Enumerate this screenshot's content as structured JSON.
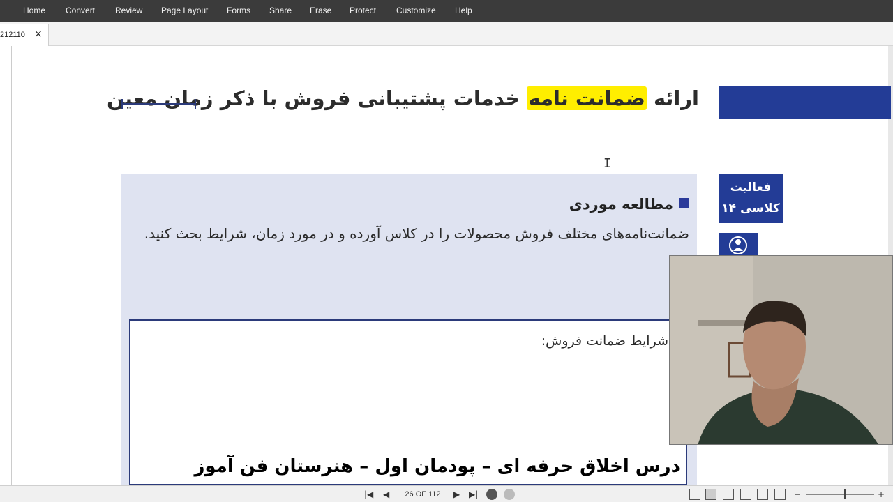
{
  "menu": {
    "items": [
      "Home",
      "Convert",
      "Review",
      "Page Layout",
      "Forms",
      "Share",
      "Erase",
      "Protect",
      "Customize",
      "Help"
    ]
  },
  "document_tab": {
    "label": "212110",
    "close": "×"
  },
  "page": {
    "title_before": "ارائه ",
    "title_highlight": "ضمانت نامه",
    "title_after": " خدمات پشتیبانی فروش با ذکر زمان معین",
    "activity_line1": "فعالیت",
    "activity_line2": "کلاسی ۱۴",
    "case_heading": "مطالعه موردی",
    "case_body": "ضمانت‌نامه‌های مختلف فروش محصولات را در کلاس آورده و در مورد زمان، شرایط بحث کنید.",
    "warranty_label": "شرایط ضمانت فروش:",
    "highlight_color": "#ffee00",
    "accent_color": "#233c96"
  },
  "overlay": {
    "caption": "درس اخلاق حرفه ای – پودمان اول – هنرستان فن آموز"
  },
  "statusbar": {
    "page_indicator": "26 OF 112",
    "first_icon": "first-page-icon",
    "prev_icon": "prev-page-icon",
    "next_icon": "next-page-icon",
    "last_icon": "last-page-icon"
  }
}
